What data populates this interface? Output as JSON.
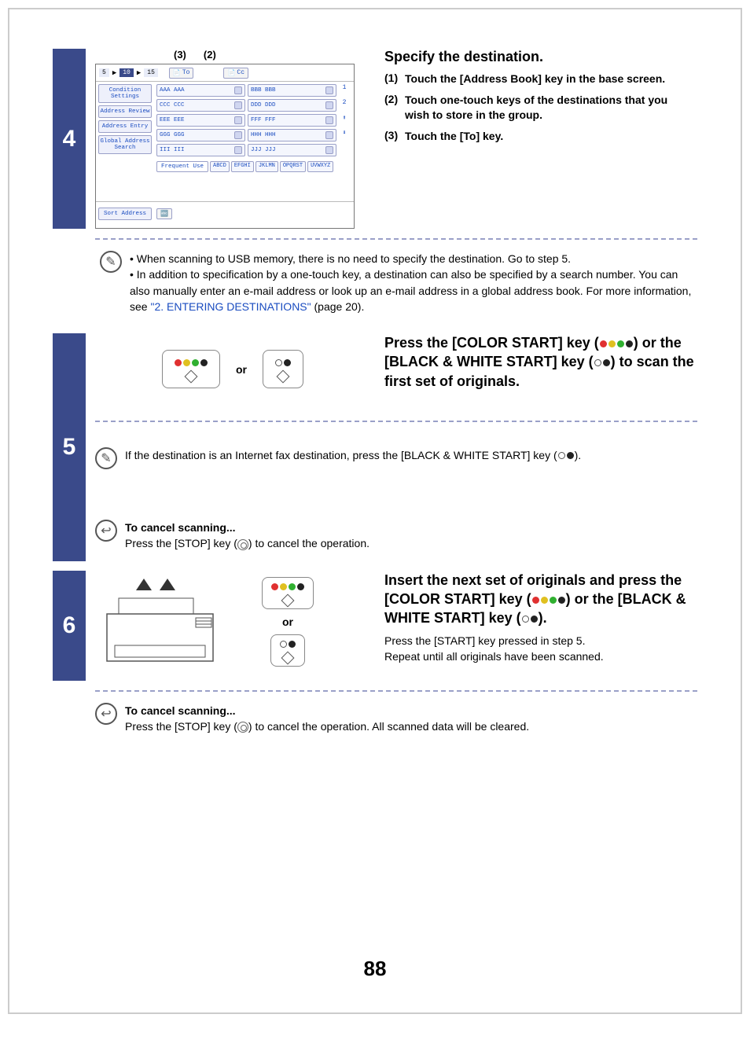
{
  "page_number": "88",
  "step4": {
    "callouts": [
      "(3)",
      "(2)"
    ],
    "num": "4",
    "heading": "Specify the destination.",
    "subs": [
      {
        "n": "(1)",
        "t": "Touch the [Address Book] key in the base screen."
      },
      {
        "n": "(2)",
        "t": "Touch one-touch keys of the destinations that you wish to store in the group."
      },
      {
        "n": "(3)",
        "t": "Touch the [To] key."
      }
    ],
    "screen": {
      "crumbs": [
        "5",
        "10",
        "15"
      ],
      "to": "To",
      "cc": "Cc",
      "side": [
        "Condition Settings",
        "Address Review",
        "Address Entry",
        "Global Address Search"
      ],
      "cellsL": [
        "AAA AAA",
        "CCC CCC",
        "EEE EEE",
        "GGG GGG",
        "III III"
      ],
      "cellsR": [
        "BBB BBB",
        "DDD DDD",
        "FFF FFF",
        "HHH HHH",
        "JJJ JJJ"
      ],
      "pager": [
        "1",
        "2"
      ],
      "tabs": [
        "ABCD",
        "EFGHI",
        "JKLMN",
        "OPQRST",
        "UVWXYZ"
      ],
      "freq": "Frequent Use",
      "sort": "Sort Address"
    },
    "note": {
      "bullets": [
        "When scanning to USB memory, there is no need to specify the destination. Go to step 5.",
        "In addition to specification by a one-touch key, a destination can also be specified by a search number. You can also manually enter an e-mail address or look up an e-mail address in a global address book. For more information, see "
      ],
      "link": "\"2. ENTERING DESTINATIONS\"",
      "after_link": " (page 20)."
    }
  },
  "step5": {
    "num": "5",
    "or": "or",
    "heading_parts": {
      "a": "Press the [COLOR START] key (",
      "b": ") or the [BLACK & WHITE START] key (",
      "c": ") to scan the first set of originals."
    },
    "note1": "If the destination is an Internet fax destination, press the [BLACK & WHITE START] key (",
    "note1b": ").",
    "cancel_h": "To cancel scanning...",
    "cancel_t_a": "Press the [STOP] key (",
    "cancel_t_b": ") to cancel the operation."
  },
  "step6": {
    "num": "6",
    "or": "or",
    "heading_parts": {
      "a": "Insert the next set of originals and press the [COLOR START] key (",
      "b": ") or the [BLACK & WHITE START] key (",
      "c": ")."
    },
    "p1": "Press the [START] key pressed in step 5.",
    "p2": "Repeat until all originals have been scanned.",
    "cancel_h": "To cancel scanning...",
    "cancel_t_a": "Press the [STOP] key (",
    "cancel_t_b": ") to cancel the operation. All scanned data will be cleared."
  }
}
